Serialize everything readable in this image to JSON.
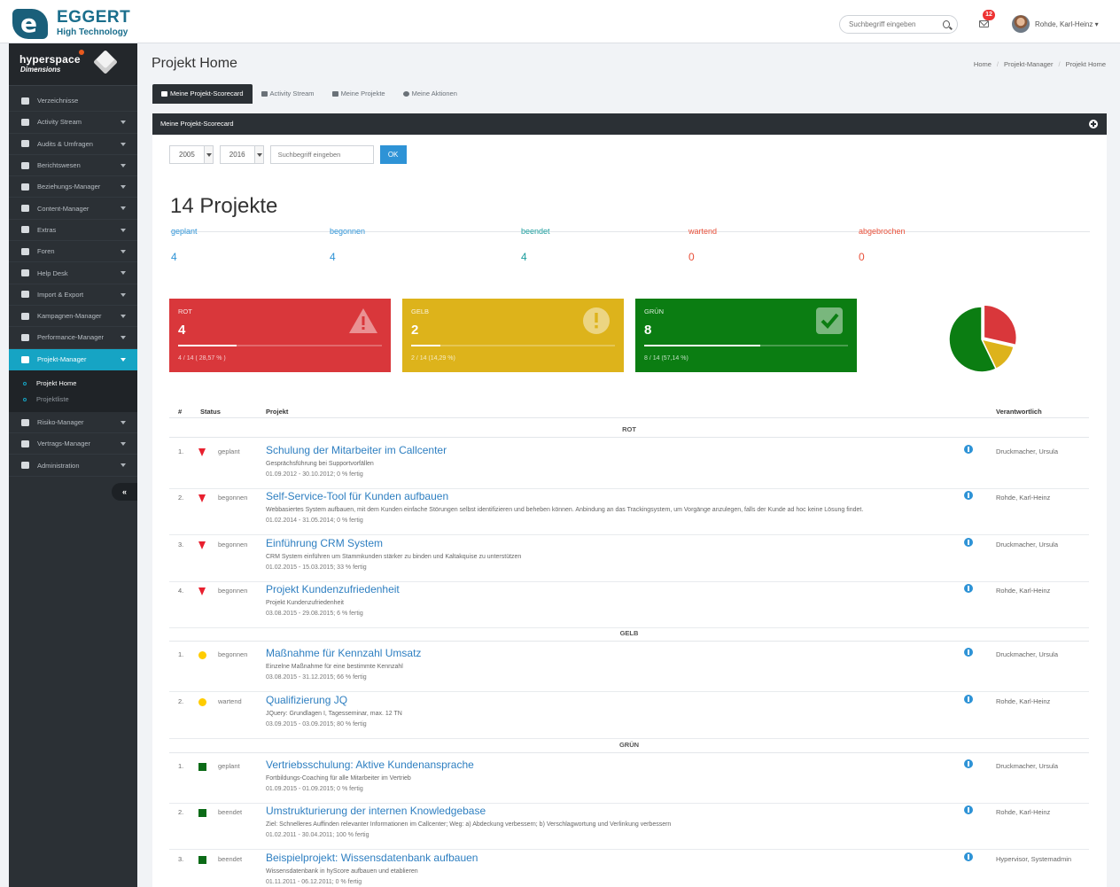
{
  "brand": {
    "name": "EGGERT",
    "tagline": "High Technology"
  },
  "topbar": {
    "search_placeholder": "Suchbegriff eingeben",
    "notifications": "12",
    "user": "Rohde, Karl-Heinz ▾"
  },
  "sidebar": {
    "product": "hyperspace",
    "product_sub": "Dimensions",
    "items": [
      {
        "label": "Verzeichnisse",
        "caret": false
      },
      {
        "label": "Activity Stream",
        "caret": true
      },
      {
        "label": "Audits & Umfragen",
        "caret": true
      },
      {
        "label": "Berichtswesen",
        "caret": true
      },
      {
        "label": "Beziehungs-Manager",
        "caret": true
      },
      {
        "label": "Content-Manager",
        "caret": true
      },
      {
        "label": "Extras",
        "caret": true
      },
      {
        "label": "Foren",
        "caret": true
      },
      {
        "label": "Help Desk",
        "caret": true
      },
      {
        "label": "Import & Export",
        "caret": true
      },
      {
        "label": "Kampagnen-Manager",
        "caret": true
      },
      {
        "label": "Performance-Manager",
        "caret": true
      },
      {
        "label": "Projekt-Manager",
        "caret": true,
        "active": true
      }
    ],
    "subitems": [
      "Projekt Home",
      "Projektliste"
    ],
    "items_after": [
      {
        "label": "Risiko-Manager",
        "caret": true
      },
      {
        "label": "Vertrags-Manager",
        "caret": true
      },
      {
        "label": "Administration",
        "caret": true
      }
    ],
    "collapse": "«"
  },
  "page": {
    "title": "Projekt Home",
    "breadcrumb": [
      "Home",
      "Projekt-Manager",
      "Projekt Home"
    ],
    "tabs": [
      "Meine Projekt-Scorecard",
      "Activity Stream",
      "Meine Projekte",
      "Meine Aktionen"
    ]
  },
  "panel": {
    "title": "Meine Projekt-Scorecard",
    "year_from": "2005",
    "year_to": "2016",
    "search_placeholder": "Suchbegriff eingeben",
    "ok": "OK",
    "count": "14 Projekte",
    "stats": [
      {
        "label": "geplant",
        "value": "4",
        "color": "#2e93d6"
      },
      {
        "label": "begonnen",
        "value": "4",
        "color": "#2e93d6"
      },
      {
        "label": "beendet",
        "value": "4",
        "color": "#1a9c9c"
      },
      {
        "label": "wartend",
        "value": "0",
        "color": "#e8503a"
      },
      {
        "label": "abgebrochen",
        "value": "0",
        "color": "#e8503a"
      }
    ],
    "cards": [
      {
        "label": "ROT",
        "value": "4",
        "foot": "4 / 14 ( 28,57 % )",
        "progress": 0.2857,
        "color": "#d9373b"
      },
      {
        "label": "GELB",
        "value": "2",
        "foot": "2 / 14 (14,29 %)",
        "progress": 0.1429,
        "color": "#ddb31b"
      },
      {
        "label": "GRÜN",
        "value": "8",
        "foot": "8 / 14 (57,14 %)",
        "progress": 0.5714,
        "color": "#0b7d12"
      }
    ],
    "table": {
      "headers": {
        "num": "#",
        "status": "Status",
        "project": "Projekt",
        "resp": "Verantwortlich"
      },
      "groups": [
        "ROT",
        "GELB",
        "GRÜN"
      ],
      "rows": [
        {
          "n": "1.",
          "status": "geplant",
          "title": "Schulung der Mitarbeiter im Callcenter",
          "desc": "Gesprächsführung bei Supportvorfällen",
          "meta": "01.09.2012 - 30.10.2012; 0 % fertig",
          "resp": "Druckmacher, Ursula"
        },
        {
          "n": "2.",
          "status": "begonnen",
          "title": "Self-Service-Tool für Kunden aufbauen",
          "desc": "Webbasiertes System aufbauen, mit dem Kunden einfache Störungen selbst identifizieren und beheben können. Anbindung an das Trackingsystem, um Vorgänge anzulegen, falls der Kunde ad hoc keine Lösung findet.",
          "meta": "01.02.2014 - 31.05.2014; 0 % fertig",
          "resp": "Rohde, Karl-Heinz"
        },
        {
          "n": "3.",
          "status": "begonnen",
          "title": "Einführung CRM System",
          "desc": "CRM System einführen um Stammkunden stärker zu binden und Kaltakquise zu unterstützen",
          "meta": "01.02.2015 - 15.03.2015; 33 % fertig",
          "resp": "Druckmacher, Ursula"
        },
        {
          "n": "4.",
          "status": "begonnen",
          "title": "Projekt Kundenzufriedenheit",
          "desc": "Projekt Kundenzufriedenheit",
          "meta": "03.08.2015 - 29.08.2015; 6 % fertig",
          "resp": "Rohde, Karl-Heinz"
        },
        {
          "n": "1.",
          "status": "begonnen",
          "title": "Maßnahme für Kennzahl Umsatz",
          "desc": "Einzelne Maßnahme für eine bestimmte Kennzahl",
          "meta": "03.08.2015 - 31.12.2015; 66 % fertig",
          "resp": "Druckmacher, Ursula"
        },
        {
          "n": "2.",
          "status": "wartend",
          "title": "Qualifizierung JQ",
          "desc": "JQuery: Grundlagen I, Tagesseminar, max. 12 TN",
          "meta": "03.09.2015 - 03.09.2015; 80 % fertig",
          "resp": "Rohde, Karl-Heinz"
        },
        {
          "n": "1.",
          "status": "geplant",
          "title": "Vertriebsschulung: Aktive Kundenansprache",
          "desc": "Fortbildungs-Coaching für alle Mitarbeiter im Vertrieb",
          "meta": "01.09.2015 - 01.09.2015; 0 % fertig",
          "resp": "Druckmacher, Ursula"
        },
        {
          "n": "2.",
          "status": "beendet",
          "title": "Umstrukturierung der internen Knowledgebase",
          "desc": "Ziel: Schnelleres Auffinden relevanter Informationen im Callcenter; Weg: a) Abdeckung verbessern; b) Verschlagwortung und Verlinkung verbessern",
          "meta": "01.02.2011 - 30.04.2011; 100 % fertig",
          "resp": "Rohde, Karl-Heinz"
        },
        {
          "n": "3.",
          "status": "beendet",
          "title": "Beispielprojekt: Wissensdatenbank aufbauen",
          "desc": "Wissensdatenbank in hyScore aufbauen und etablieren",
          "meta": "01.11.2011 - 06.12.2011; 0 % fertig",
          "resp": "Hypervisor, Systemadmin"
        }
      ]
    }
  }
}
